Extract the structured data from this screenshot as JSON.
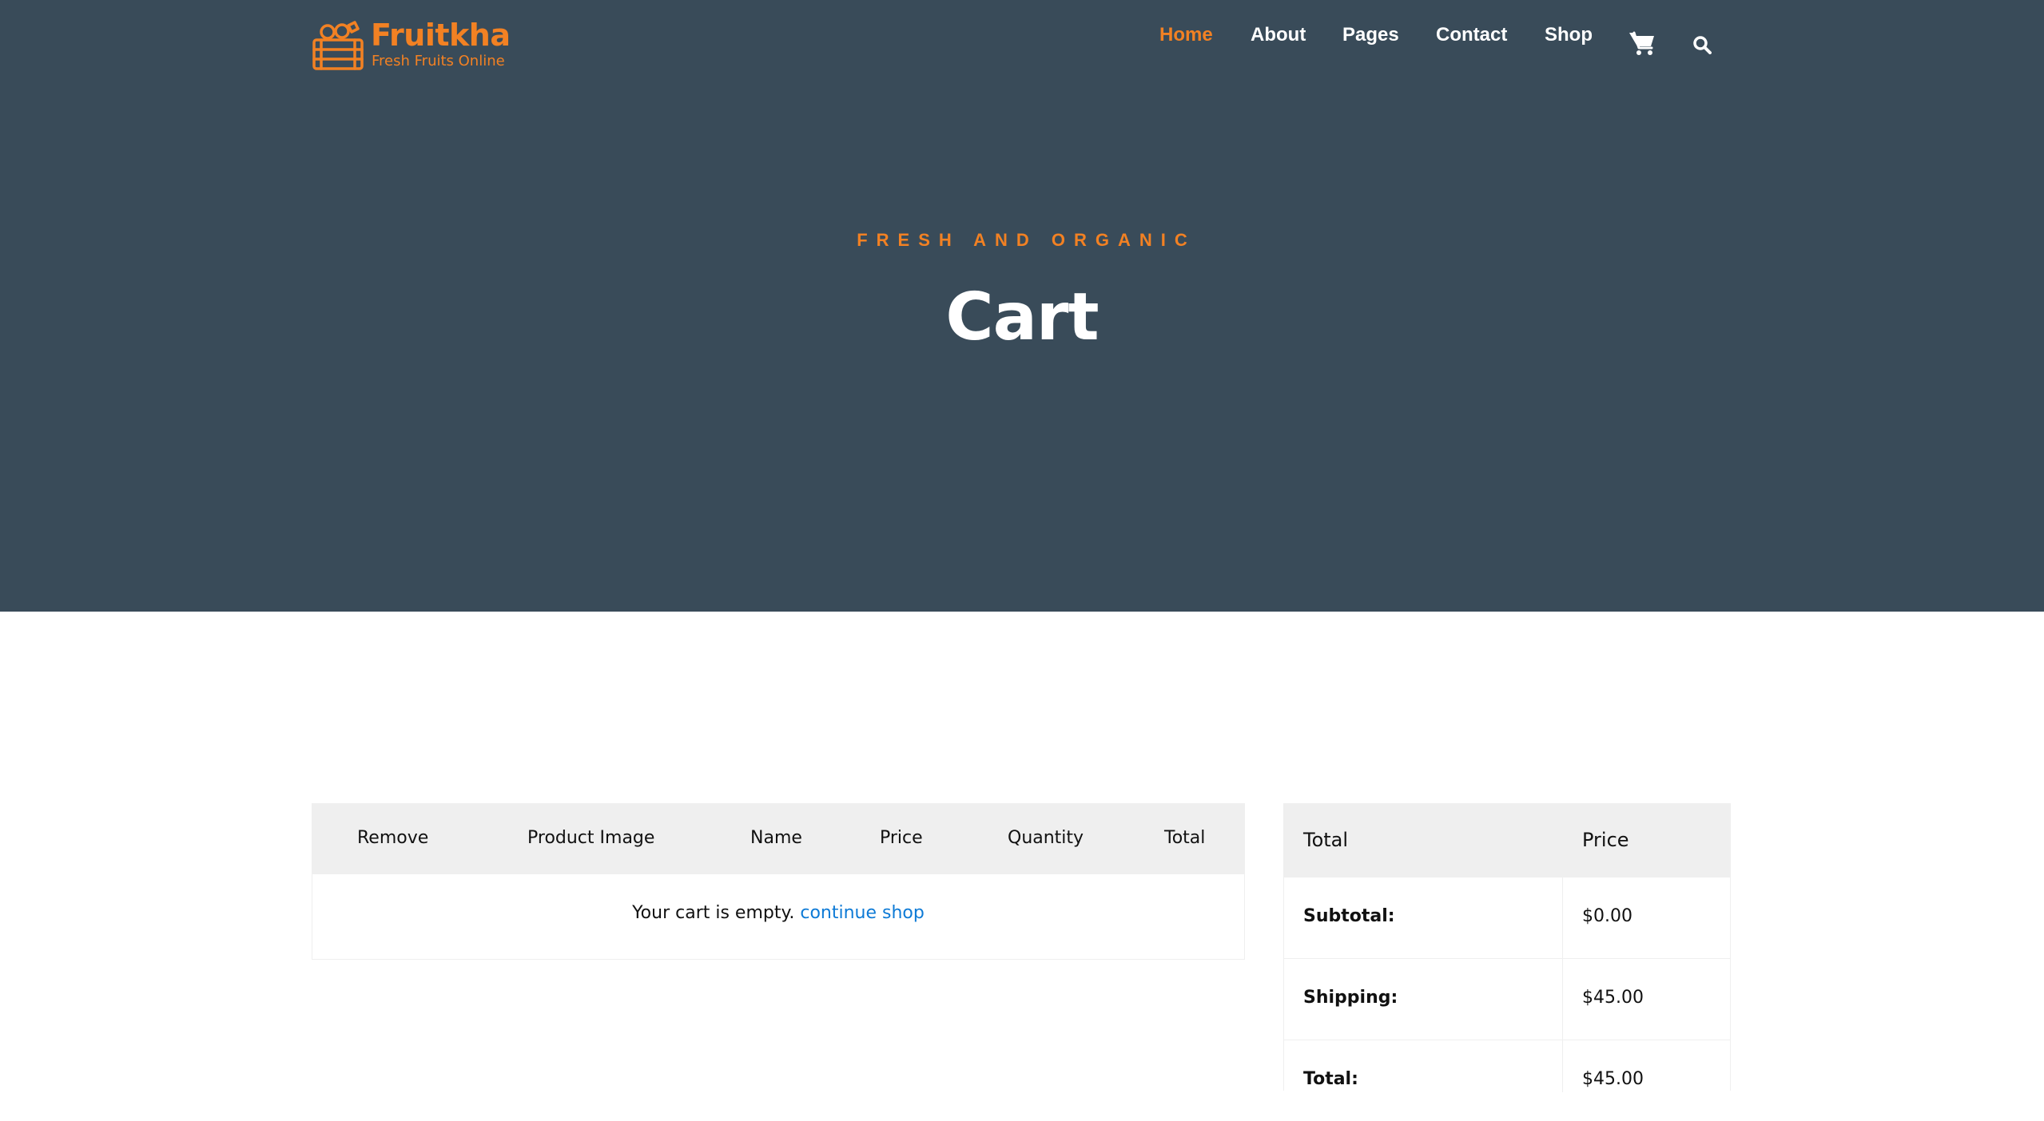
{
  "brand": {
    "name": "Fruitkha",
    "tagline": "Fresh Fruits Online",
    "color": "#f28123",
    "logo_icon": "fruit-crate-icon"
  },
  "nav": {
    "items": [
      {
        "label": "Home",
        "active": true
      },
      {
        "label": "About",
        "active": false
      },
      {
        "label": "Pages",
        "active": false
      },
      {
        "label": "Contact",
        "active": false
      },
      {
        "label": "Shop",
        "active": false
      }
    ],
    "icons": [
      "cart-icon",
      "search-icon"
    ]
  },
  "hero": {
    "subtitle": "FRESH AND ORGANIC",
    "title": "Cart",
    "background": "#394b59"
  },
  "cart": {
    "columns": [
      "Remove",
      "Product Image",
      "Name",
      "Price",
      "Quantity",
      "Total"
    ],
    "empty_text": "Your cart is empty.",
    "continue_link": "continue shop",
    "link_color": "#0d7ad6"
  },
  "totals": {
    "headers": [
      "Total",
      "Price"
    ],
    "rows": [
      {
        "label": "Subtotal:",
        "value": "$0.00"
      },
      {
        "label": "Shipping:",
        "value": "$45.00"
      },
      {
        "label": "Total:",
        "value": "$45.00"
      }
    ]
  }
}
